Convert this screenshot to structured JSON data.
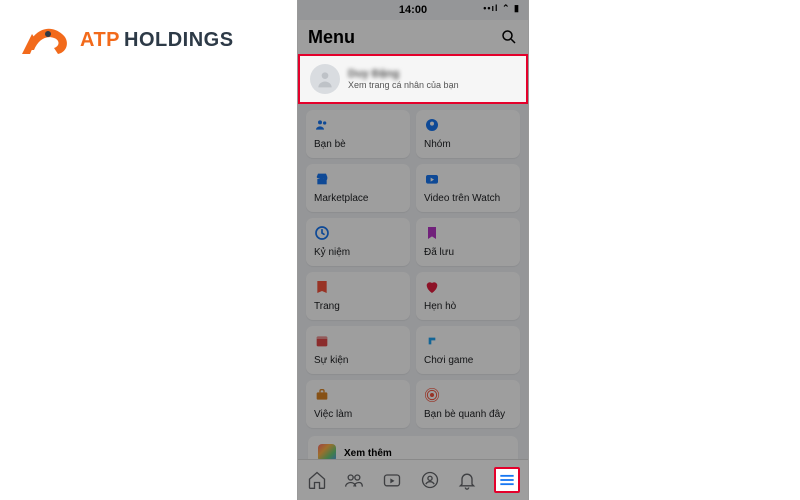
{
  "brand": {
    "atp": "ATP",
    "holdings": "HOLDINGS"
  },
  "status": {
    "time": "14:00"
  },
  "header": {
    "title": "Menu"
  },
  "profile": {
    "name": "Duy Đặng",
    "subtitle": "Xem trang cá nhân của bạn"
  },
  "tiles": [
    {
      "label": "Bạn bè",
      "icon": "friends",
      "color": "#1877f2"
    },
    {
      "label": "Nhóm",
      "icon": "groups",
      "color": "#1877f2"
    },
    {
      "label": "Marketplace",
      "icon": "marketplace",
      "color": "#1877f2"
    },
    {
      "label": "Video trên Watch",
      "icon": "watch",
      "color": "#1877f2"
    },
    {
      "label": "Kỷ niệm",
      "icon": "memories",
      "color": "#1877f2"
    },
    {
      "label": "Đã lưu",
      "icon": "saved",
      "color": "#b736c7"
    },
    {
      "label": "Trang",
      "icon": "pages",
      "color": "#f5533d"
    },
    {
      "label": "Hẹn hò",
      "icon": "dating",
      "color": "#e41e3f"
    },
    {
      "label": "Sự kiện",
      "icon": "events",
      "color": "#e04848"
    },
    {
      "label": "Chơi game",
      "icon": "gaming",
      "color": "#20a4f3"
    },
    {
      "label": "Việc làm",
      "icon": "jobs",
      "color": "#d98324"
    },
    {
      "label": "Bạn bè quanh đây",
      "icon": "nearby",
      "color": "#f5533d"
    }
  ],
  "seemore": {
    "label": "Xem thêm"
  },
  "tabs": [
    "home",
    "friends",
    "watch",
    "groups",
    "notifications",
    "menu"
  ]
}
